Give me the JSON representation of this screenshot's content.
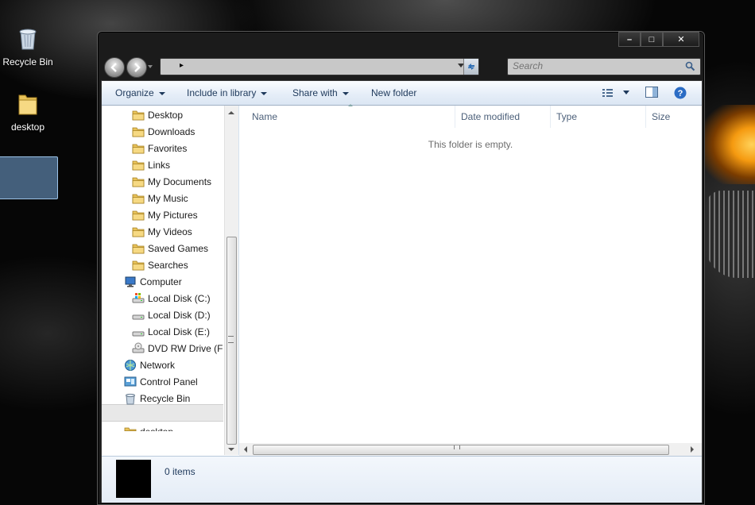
{
  "desktop": {
    "icons": [
      {
        "label": "Recycle Bin"
      },
      {
        "label": "desktop"
      }
    ]
  },
  "window": {
    "caption": {
      "minimize": "–",
      "maximize": "□",
      "close": "✕"
    },
    "address": {
      "path_arrow": "▸"
    },
    "search": {
      "placeholder": "Search"
    },
    "toolbar": {
      "organize": "Organize",
      "include_in_library": "Include in library",
      "share_with": "Share with",
      "new_folder": "New folder"
    },
    "nav_tree": [
      {
        "label": "Desktop",
        "icon": "folder-icon"
      },
      {
        "label": "Downloads",
        "icon": "downloads-folder-icon"
      },
      {
        "label": "Favorites",
        "icon": "favorites-folder-icon"
      },
      {
        "label": "Links",
        "icon": "links-folder-icon"
      },
      {
        "label": "My Documents",
        "icon": "documents-folder-icon"
      },
      {
        "label": "My Music",
        "icon": "music-folder-icon"
      },
      {
        "label": "My Pictures",
        "icon": "pictures-folder-icon"
      },
      {
        "label": "My Videos",
        "icon": "videos-folder-icon"
      },
      {
        "label": "Saved Games",
        "icon": "saved-games-folder-icon"
      },
      {
        "label": "Searches",
        "icon": "searches-folder-icon"
      },
      {
        "label": "Computer",
        "icon": "computer-icon"
      },
      {
        "label": "Local Disk (C:)",
        "icon": "system-drive-icon"
      },
      {
        "label": "Local Disk (D:)",
        "icon": "drive-icon"
      },
      {
        "label": "Local Disk (E:)",
        "icon": "drive-icon"
      },
      {
        "label": "DVD RW Drive (F:)",
        "icon": "dvd-drive-icon"
      },
      {
        "label": "Network",
        "icon": "network-icon"
      },
      {
        "label": "Control Panel",
        "icon": "control-panel-icon"
      },
      {
        "label": "Recycle Bin",
        "icon": "recycle-bin-icon"
      },
      {
        "label": "",
        "icon": ""
      },
      {
        "label": "desktop",
        "icon": "folder-icon"
      }
    ],
    "columns": {
      "name": "Name",
      "date_modified": "Date modified",
      "type": "Type",
      "size": "Size"
    },
    "empty_message": "This folder is empty.",
    "status": {
      "items": "0 items"
    },
    "colors": {
      "toolbar_text": "#1e395b",
      "selection": "#9cc3e8"
    }
  }
}
